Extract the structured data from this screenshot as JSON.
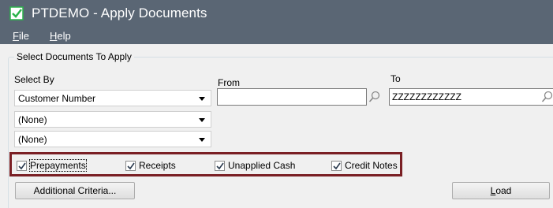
{
  "window": {
    "title": "PTDEMO - Apply Documents",
    "icon": "sage-check-icon",
    "accent": "#5a6674",
    "icon_color": "#2bb34a"
  },
  "menu": {
    "items": [
      {
        "label": "File",
        "mnemonic": "F",
        "rest": "ile"
      },
      {
        "label": "Help",
        "mnemonic": "H",
        "rest": "elp"
      }
    ]
  },
  "select_docs": {
    "group_title": "Select Documents To Apply",
    "select_by_label": "Select By",
    "from_label": "From",
    "to_label": "To",
    "criteria": [
      {
        "value": "Customer Number",
        "from": "",
        "to": "ZZZZZZZZZZZZ"
      },
      {
        "value": "(None)"
      },
      {
        "value": "(None)"
      }
    ],
    "document_types": [
      {
        "label": "Prepayments",
        "checked": true
      },
      {
        "label": "Receipts",
        "checked": true
      },
      {
        "label": "Unapplied Cash",
        "checked": true
      },
      {
        "label": "Credit Notes",
        "checked": true
      }
    ],
    "highlight_color": "#7a1f24",
    "additional_criteria_label": "Additional Criteria...",
    "load_label": "Load",
    "load_mnemonic": "L",
    "load_rest": "oad"
  }
}
